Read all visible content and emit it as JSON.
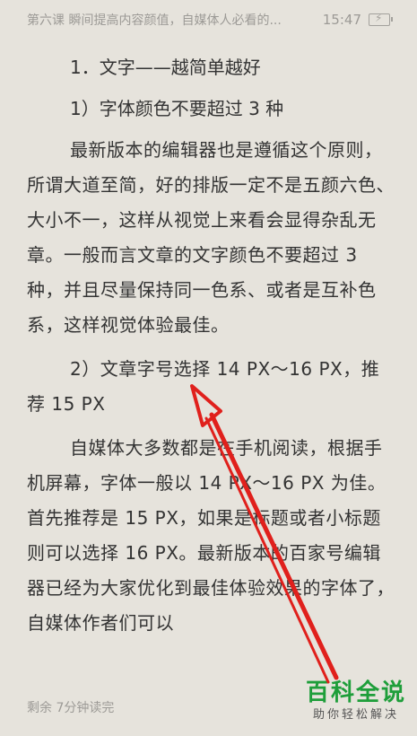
{
  "status": {
    "title": "第六课 瞬间提高内容颜值，自媒体人必看的...",
    "time": "15:47",
    "battery_icon": "battery-charging-icon"
  },
  "article": {
    "heading": "1．文字——越简单越好",
    "sub1": "1）字体颜色不要超过 3 种",
    "para1": "最新版本的编辑器也是遵循这个原则，所谓大道至简，好的排版一定不是五颜六色、大小不一，这样从视觉上来看会显得杂乱无章。一般而言文章的文字颜色不要超过 3 种，并且尽量保持同一色系、或者是互补色系，这样视觉体验最佳。",
    "sub2": "2）文章字号选择 14 PX～16 PX，推荐 15 PX",
    "para2": "自媒体大多数都是在手机阅读，根据手机屏幕，字体一般以 14 PX～16 PX 为佳。首先推荐是 15 PX，如果是标题或者小标题则可以选择 16 PX。最新版本的百家号编辑器已经为大家优化到最佳体验效果的字体了，自媒体作者们可以"
  },
  "footer": {
    "remaining": "剩余 7分钟读完"
  },
  "watermark": {
    "title": "百科全说",
    "subtitle": "助你轻松解决"
  },
  "colors": {
    "background": "#e6e3dc",
    "text": "#333333",
    "arrow": "#e0201c",
    "watermark_green": "#1e9e3a"
  }
}
